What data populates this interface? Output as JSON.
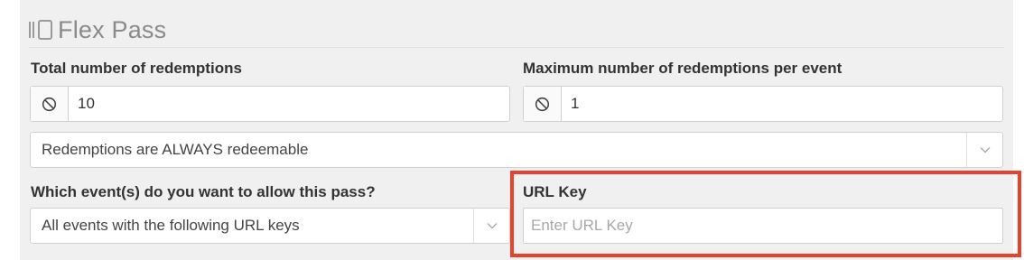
{
  "section": {
    "title": "Flex Pass",
    "icon": "flex-pass-icon"
  },
  "fields": {
    "total_redemptions": {
      "label": "Total number of redemptions",
      "value": "10",
      "addon_icon": "ban-icon"
    },
    "max_per_event": {
      "label": "Maximum number of redemptions per event",
      "value": "1",
      "addon_icon": "ban-icon"
    },
    "redeemable": {
      "selected": "Redemptions are ALWAYS redeemable",
      "caret_icon": "chevron-down-icon"
    },
    "events": {
      "label": "Which event(s) do you want to allow this pass?",
      "selected": "All events with the following URL keys",
      "caret_icon": "chevron-down-icon"
    },
    "url_key": {
      "label": "URL Key",
      "placeholder": "Enter URL Key",
      "value": ""
    }
  },
  "colors": {
    "panel_bg": "#f0f0f0",
    "highlight": "#e8412d"
  }
}
